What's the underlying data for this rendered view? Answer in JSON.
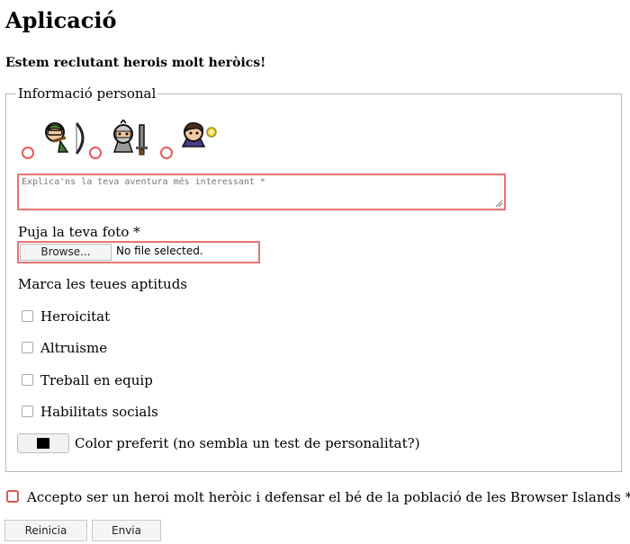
{
  "page": {
    "title": "Aplicació",
    "subtitle": "Estem reclutant herois molt heròics!"
  },
  "form": {
    "legend": "Informació personal",
    "heroes": [
      {
        "icon": "archer-hero-icon"
      },
      {
        "icon": "knight-hero-icon"
      },
      {
        "icon": "mage-hero-icon"
      }
    ],
    "adventure_placeholder": "Explica'ns la teva aventura més interessant *",
    "photo_label": "Puja la teva foto *",
    "browse_label": "Browse...",
    "file_status": "No file selected.",
    "skills_label": "Marca les teues aptituds",
    "skills": [
      "Heroicitat",
      "Altruisme",
      "Treball en equip",
      "Habilitats socials"
    ],
    "color_label": "Color preferit (no sembla un test de personalitat?)",
    "color_value": "#000000",
    "invalid_color": "#e87272"
  },
  "footer": {
    "accept_label": "Accepto ser un heroi molt heròic i defensar el bé de la població de les Browser Islands *",
    "reset_label": "Reinicia",
    "submit_label": "Envia"
  }
}
